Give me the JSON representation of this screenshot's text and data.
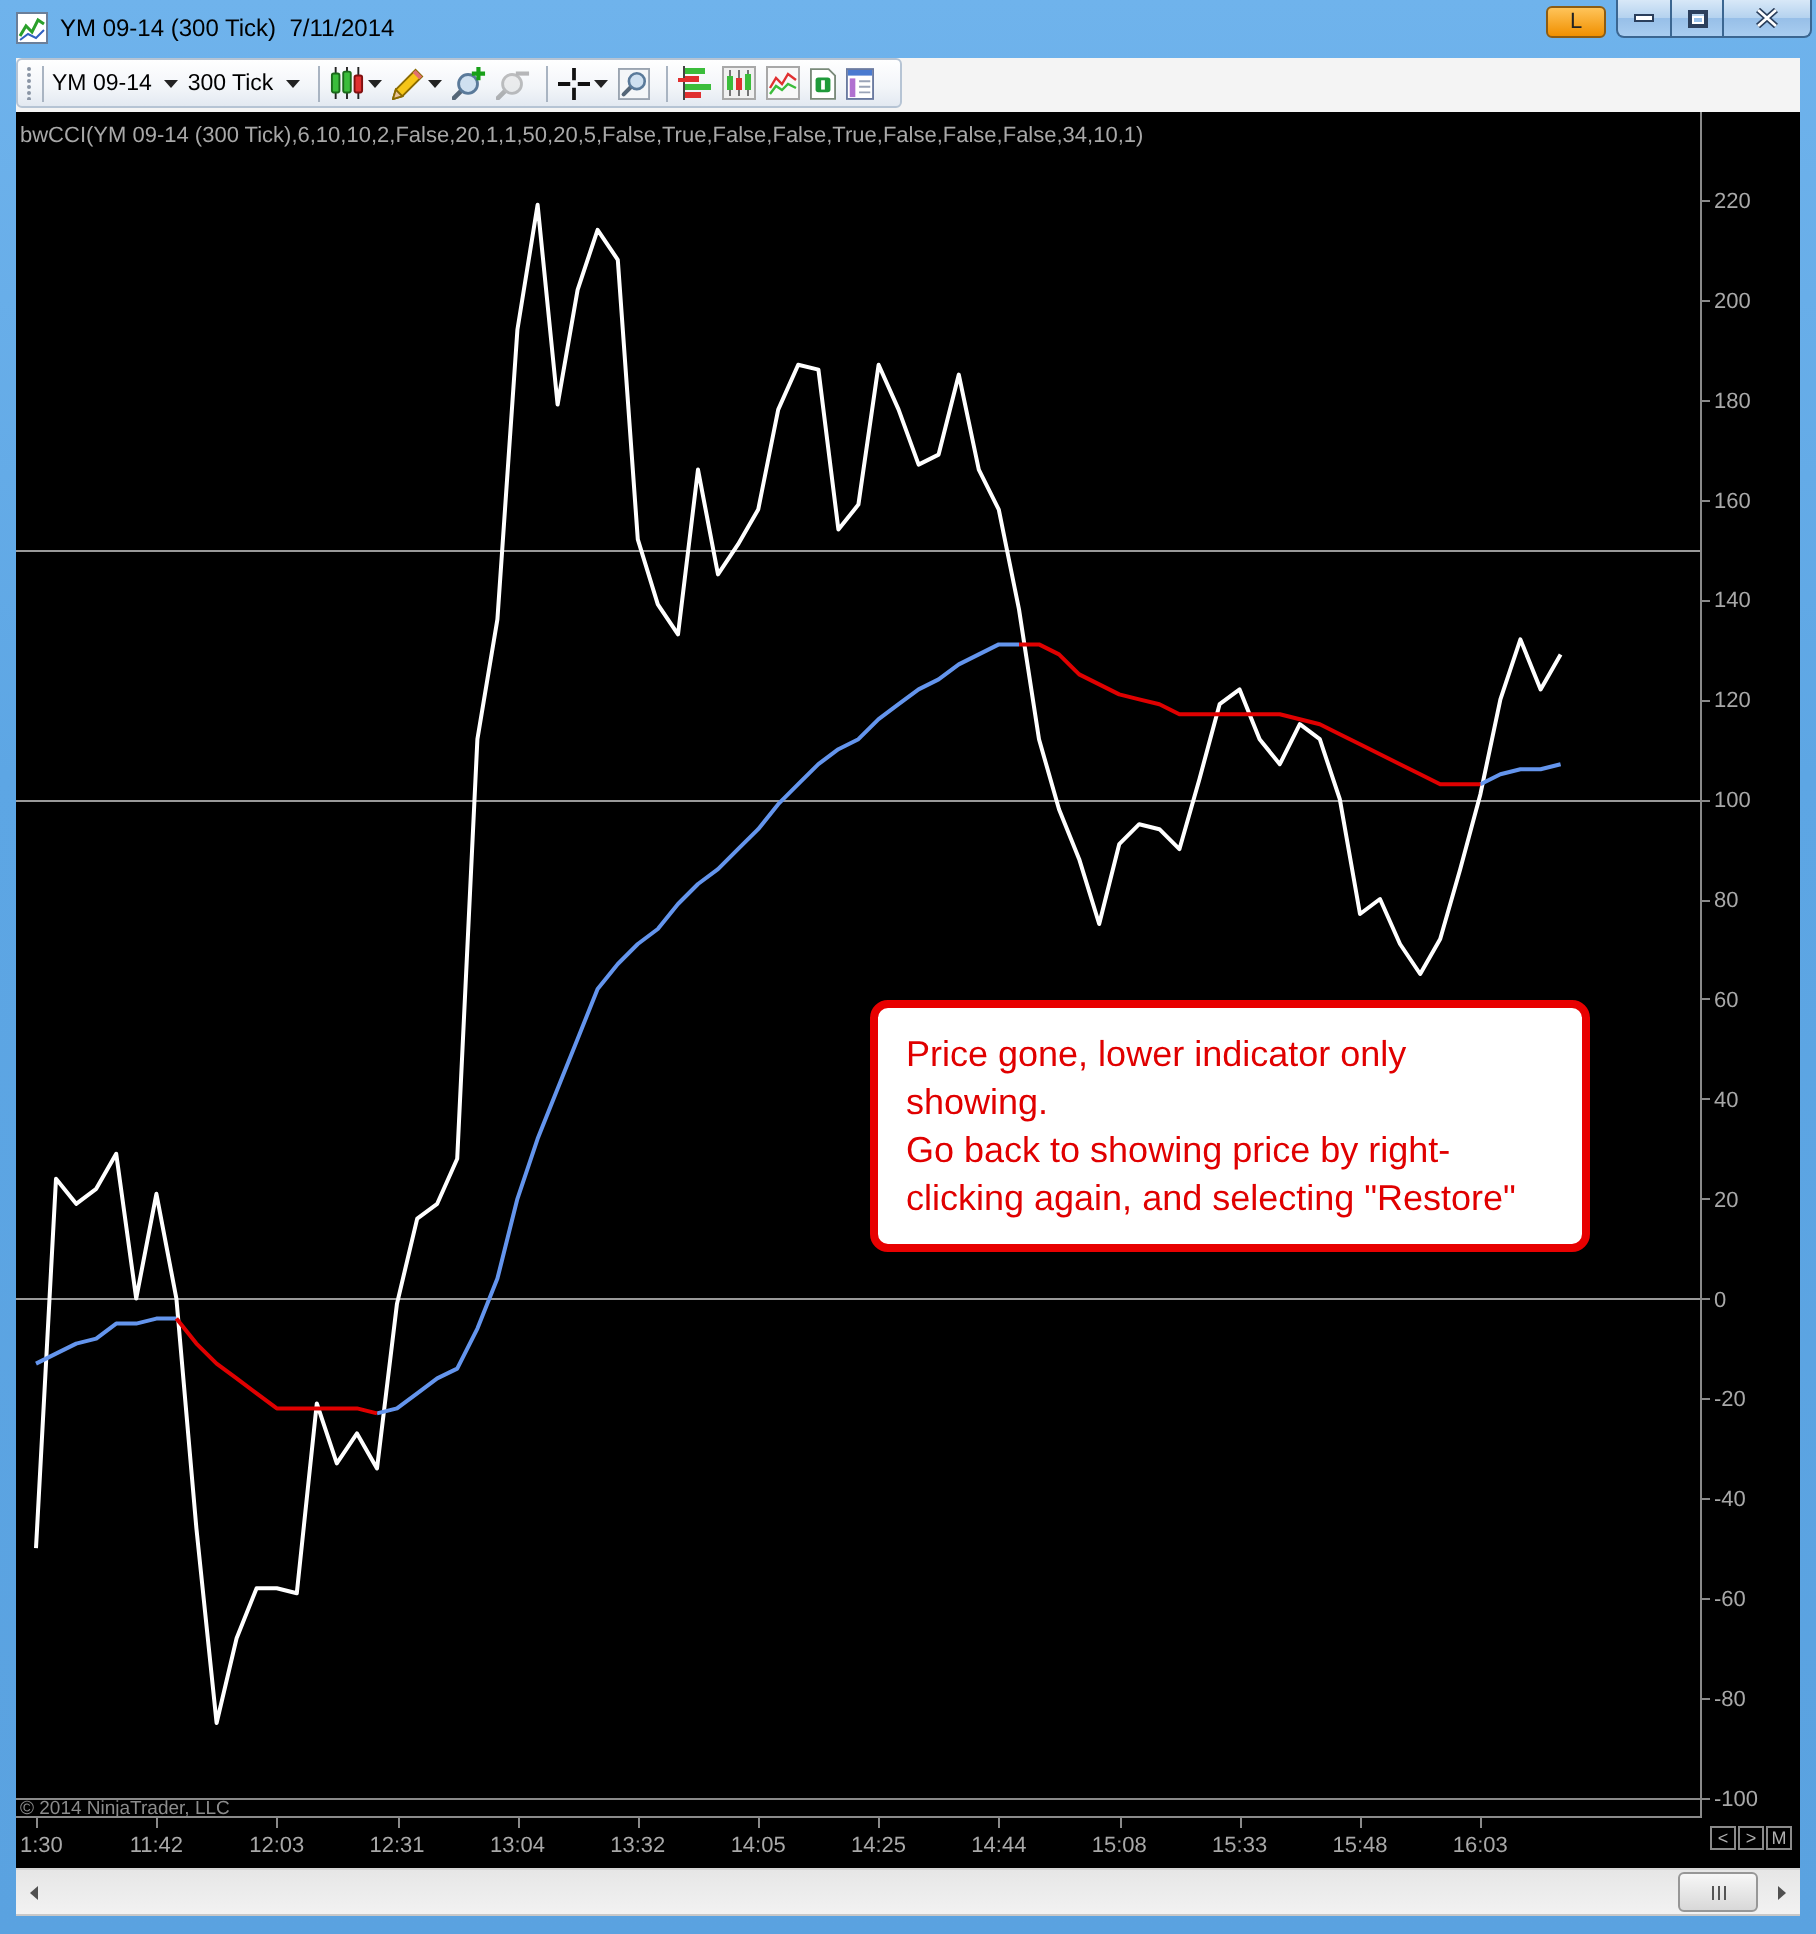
{
  "window": {
    "title": "YM 09-14 (300 Tick)  7/11/2014",
    "title_button": "L"
  },
  "toolbar": {
    "dropdowns": [
      {
        "label": "YM 09-14"
      },
      {
        "label": "300 Tick"
      }
    ],
    "groups": [
      [
        {
          "kind": "candles",
          "disabled": false
        },
        {
          "kind": "caret",
          "disabled": false
        },
        {
          "kind": "pencil",
          "disabled": false
        },
        {
          "kind": "caret",
          "disabled": false
        },
        {
          "kind": "zoomin",
          "disabled": false
        },
        {
          "kind": "zoomout",
          "disabled": true
        }
      ],
      [
        {
          "kind": "crosshair",
          "disabled": false
        },
        {
          "kind": "caret",
          "disabled": false
        },
        {
          "kind": "zoombox",
          "disabled": false
        }
      ],
      [
        {
          "kind": "bars",
          "disabled": false
        },
        {
          "kind": "candlechart",
          "disabled": false
        },
        {
          "kind": "linechart",
          "disabled": false
        },
        {
          "kind": "document",
          "disabled": false
        },
        {
          "kind": "panel",
          "disabled": false
        }
      ]
    ]
  },
  "chart": {
    "chart_data": {
      "type": "line",
      "title": "bwCCI(YM 09-14 (300 Tick),6,10,10,2,False,20,1,1,50,20,5,False,True,False,False,True,False,False,False,34,10,1)",
      "categories": [
        "1:30",
        null,
        null,
        null,
        null,
        null,
        "11:42",
        null,
        null,
        null,
        null,
        null,
        "12:03",
        null,
        null,
        null,
        null,
        null,
        "12:31",
        null,
        null,
        null,
        null,
        null,
        "13:04",
        null,
        null,
        null,
        null,
        null,
        "13:32",
        null,
        null,
        null,
        null,
        null,
        "14:05",
        null,
        null,
        null,
        null,
        null,
        "14:25",
        null,
        null,
        null,
        null,
        null,
        "14:44",
        null,
        null,
        null,
        null,
        null,
        "15:08",
        null,
        null,
        null,
        null,
        null,
        "15:33",
        null,
        null,
        null,
        null,
        null,
        "15:48",
        null,
        null,
        null,
        null,
        null,
        "16:03",
        null,
        null,
        null,
        null
      ],
      "ylim": [
        -100,
        237.6
      ],
      "yticks": [
        -100,
        -80,
        -60,
        -40,
        -20,
        0,
        20,
        40,
        60,
        80,
        100,
        120,
        140,
        160,
        180,
        200,
        220
      ],
      "series": [
        {
          "color": "#ffffff",
          "values": [
            -50,
            24,
            19,
            22,
            29,
            0,
            21,
            0,
            -46,
            -85,
            -68,
            -58,
            -58,
            -59,
            -21,
            -33,
            -27,
            -34,
            -1,
            16,
            19,
            28,
            112,
            136,
            194,
            219,
            179,
            202,
            214,
            208,
            152,
            139,
            133,
            166,
            145,
            151,
            158,
            178,
            187,
            186,
            154,
            159,
            187,
            178,
            167,
            169,
            185,
            166,
            158,
            138,
            112,
            98,
            88,
            75,
            91,
            95,
            94,
            90,
            104,
            119,
            122,
            112,
            107,
            115,
            112,
            100,
            77,
            80,
            71,
            65,
            72,
            86,
            101,
            120,
            132,
            122,
            129
          ]
        },
        {
          "color": "#6495ed",
          "values": [
            -13,
            -11,
            -9,
            -8,
            -5,
            -5,
            -4,
            -4,
            null,
            null,
            null,
            null,
            null,
            null,
            null,
            null,
            null,
            -23,
            -22,
            -19,
            -16,
            -14,
            -6,
            4,
            20,
            32,
            42,
            52,
            62,
            67,
            71,
            74,
            79,
            83,
            86,
            90,
            94,
            99,
            103,
            107,
            110,
            112,
            116,
            119,
            122,
            124,
            127,
            129,
            131,
            131,
            null,
            null,
            null,
            null,
            null,
            null,
            null,
            null,
            null,
            null,
            null,
            null,
            null,
            null,
            null,
            null,
            null,
            null,
            null,
            null,
            null,
            null,
            103,
            105,
            106,
            106,
            107
          ]
        },
        {
          "color": "#e00000",
          "values": [
            null,
            null,
            null,
            null,
            null,
            null,
            null,
            -4,
            -9,
            -13,
            -16,
            -19,
            -22,
            -22,
            -22,
            -22,
            -22,
            -23,
            null,
            null,
            null,
            null,
            null,
            null,
            null,
            null,
            null,
            null,
            null,
            null,
            null,
            null,
            null,
            null,
            null,
            null,
            null,
            null,
            null,
            null,
            null,
            null,
            null,
            null,
            null,
            null,
            null,
            null,
            null,
            131,
            131,
            129,
            125,
            123,
            121,
            120,
            119,
            117,
            117,
            117,
            117,
            117,
            117,
            116,
            115,
            113,
            111,
            109,
            107,
            105,
            103,
            103,
            103,
            null,
            null,
            null,
            null
          ]
        }
      ],
      "ref_lines": [
        {
          "axis": "y",
          "value": 150
        },
        {
          "axis": "y",
          "value": 100
        },
        {
          "axis": "y",
          "value": 0
        }
      ]
    },
    "copyright": "© 2014 NinjaTrader, LLC",
    "nav_buttons": [
      "<",
      ">",
      "M"
    ]
  },
  "callout": {
    "paragraphs": [
      "Price gone, lower indicator only showing.",
      "Go back to showing price by right-clicking again, and selecting \"Restore\""
    ]
  }
}
